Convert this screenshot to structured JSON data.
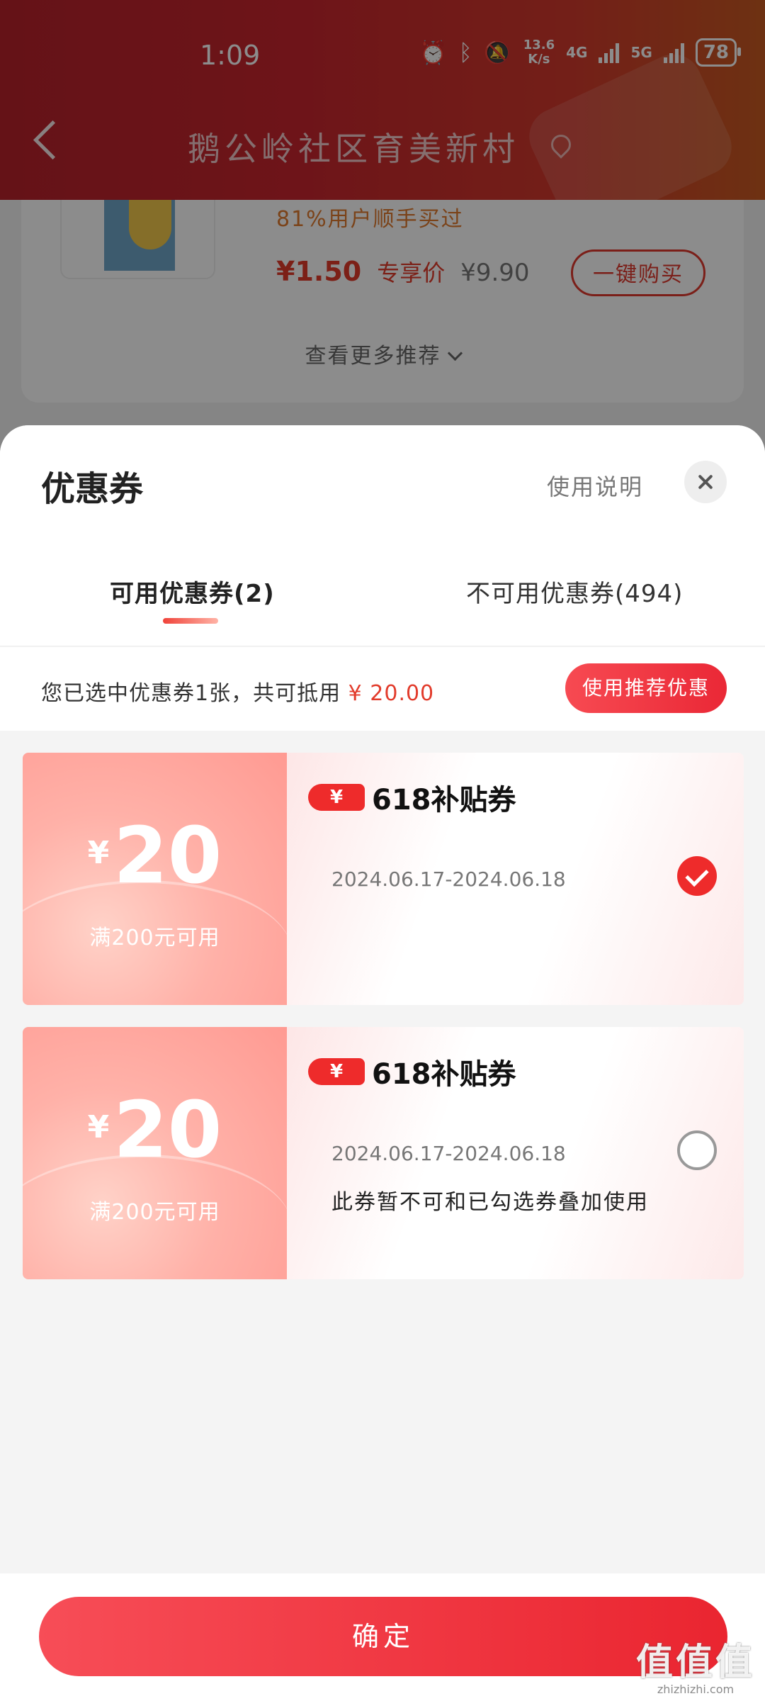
{
  "status_bar": {
    "time": "1:09",
    "speed_value": "13.6",
    "speed_unit": "K/s",
    "network_1": "4G",
    "network_2": "5G",
    "battery": "78"
  },
  "nav": {
    "title": "鹅公岭社区育美新村"
  },
  "product": {
    "bought_text": "81%用户顺手买过",
    "price_now": "¥1.50",
    "price_tag": "专享价",
    "price_old": "¥9.90",
    "buy_label": "一键购买",
    "more_label": "查看更多推荐"
  },
  "sheet": {
    "title": "优惠券",
    "help_label": "使用说明",
    "tabs": [
      {
        "label": "可用优惠券(2)"
      },
      {
        "label": "不可用优惠券(494)"
      }
    ],
    "summary_prefix": "您已选中优惠券1张，共可抵用",
    "summary_amount": "¥ 20.00",
    "recommend_label": "使用推荐优惠"
  },
  "coupons": [
    {
      "yen": "¥",
      "amount": "20",
      "condition": "满200元可用",
      "badge_icon": "¥",
      "name": "618补贴券",
      "validity": "2024.06.17-2024.06.18",
      "note": "",
      "selected": true
    },
    {
      "yen": "¥",
      "amount": "20",
      "condition": "满200元可用",
      "badge_icon": "¥",
      "name": "618补贴券",
      "validity": "2024.06.17-2024.06.18",
      "note": "此券暂不可和已勾选券叠加使用",
      "selected": false
    }
  ],
  "footer": {
    "confirm_label": "确定"
  },
  "watermark": {
    "logo": "值值值",
    "domain": "zhizhizhi.com"
  },
  "colors": {
    "accent": "#ea2836",
    "header_red": "#c9262e",
    "price_red": "#e23b2b"
  }
}
